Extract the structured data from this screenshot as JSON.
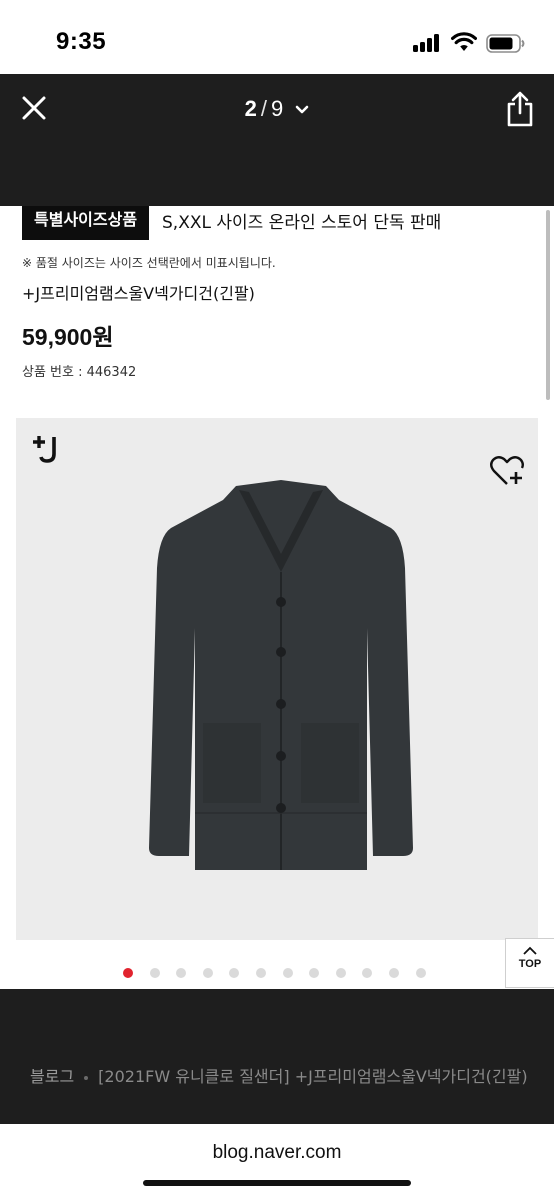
{
  "status_bar": {
    "time": "9:35"
  },
  "viewer": {
    "current_page": "2",
    "separator": "/",
    "total_pages": "9"
  },
  "product": {
    "badge": "특별사이즈상품",
    "badge_desc": "S,XXL 사이즈 온라인 스토어 단독 판매",
    "notice": "※ 품절 사이즈는 사이즈 선택란에서 미표시됩니다.",
    "name": "+J프리미엄램스울V넥가디건(긴팔)",
    "price": "59,900원",
    "product_no": "상품 번호 : 446342"
  },
  "carousel": {
    "total_dots": 12,
    "active_index": 0
  },
  "top_button": {
    "label": "TOP"
  },
  "breadcrumb": {
    "site": "블로그",
    "title": "[2021FW 유니클로 질샌더] +J프리미엄램스울V넥가디건(긴팔)"
  },
  "browser": {
    "url": "blog.naver.com"
  },
  "colors": {
    "viewer_bar": "#1e1e1e",
    "badge_bg": "#0d0d0d",
    "active_dot": "#e1232e",
    "image_bg": "#ececec",
    "cardigan": "#33373a"
  },
  "icons": {
    "close": "close-icon",
    "dropdown": "chevron-down-icon",
    "share": "share-icon",
    "wishlist": "heart-plus-icon",
    "top": "chevron-up-icon"
  }
}
